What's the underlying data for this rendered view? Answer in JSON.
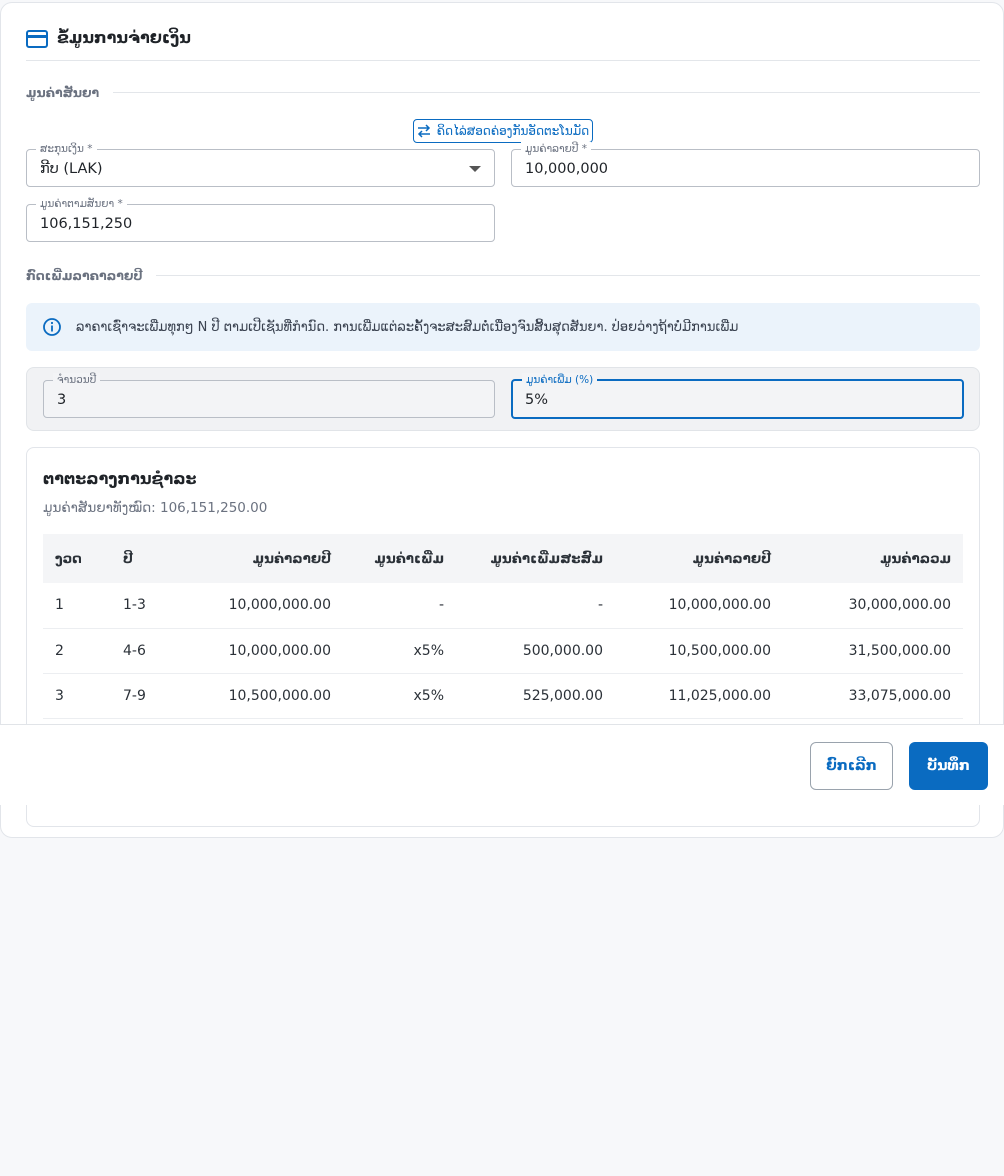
{
  "header": {
    "title": "ຂໍ້ມູນການຈ່າຍເງິນ",
    "icon": "credit-card-icon"
  },
  "contract_value_section": {
    "label": "ມູນຄ່າສັນຍາ",
    "toggle_button_label": "ຄິດໄລ່ສອດຄ່ອງກັນອັດຕະໂນມັດ",
    "currency": {
      "label": "ສະກຸນເງິນ *",
      "value": "ກີບ (LAK)"
    },
    "annual_value": {
      "label": "ມູນຄ່າລາຍປີ *",
      "value": "10,000,000"
    },
    "contract_value": {
      "label": "ມູນຄ່າຕາມສັນຍາ *",
      "value": "106,151,250"
    }
  },
  "escalation_section": {
    "label": "ກົດເພີ່ມລາຄາລາຍປີ",
    "info_text": "ລາຄາເຊົ່າຈະເພີ່ມທຸກໆ N ປີ ຕາມເປີເຊັນທີ່ກຳນົດ. ການເພີ່ມແຕ່ລະຄັ້ງຈະສະສົມຕໍ່ເນື່ອງຈົນສິ້ນສຸດສັນຍາ. ປ່ອຍວ່າງຖ້າບໍ່ມີການເພີ່ມ",
    "years": {
      "label": "ຈຳນວນປີ",
      "value": "3"
    },
    "increase": {
      "label": "ມູນຄ່າເພີ່ມ (%)",
      "value": "5%"
    }
  },
  "schedule": {
    "title": "ຕາຕະລາງການຊຳລະ",
    "subtitle": "ມູນຄ່າສັນຍາທັງໝົດ: 106,151,250.00",
    "columns": [
      "ງວດ",
      "ປີ",
      "ມູນຄ່າລາຍປີ",
      "ມູນຄ່າເພີ່ມ",
      "ມູນຄ່າເພີ່ມສະສົມ",
      "ມູນຄ່າລາຍປີ",
      "ມູນຄ່າລວມ"
    ],
    "rows": [
      [
        "1",
        "1-3",
        "10,000,000.00",
        "-",
        "-",
        "10,000,000.00",
        "30,000,000.00"
      ],
      [
        "2",
        "4-6",
        "10,000,000.00",
        "x5%",
        "500,000.00",
        "10,500,000.00",
        "31,500,000.00"
      ],
      [
        "3",
        "7-9",
        "10,500,000.00",
        "x5%",
        "525,000.00",
        "11,025,000.00",
        "33,075,000.00"
      ]
    ]
  },
  "footer": {
    "cancel_label": "ຍົກເລີກ",
    "save_label": "ບັນທຶກ"
  },
  "colors": {
    "primary": "#0a6bc1",
    "info_bg": "#ebf3fb"
  }
}
